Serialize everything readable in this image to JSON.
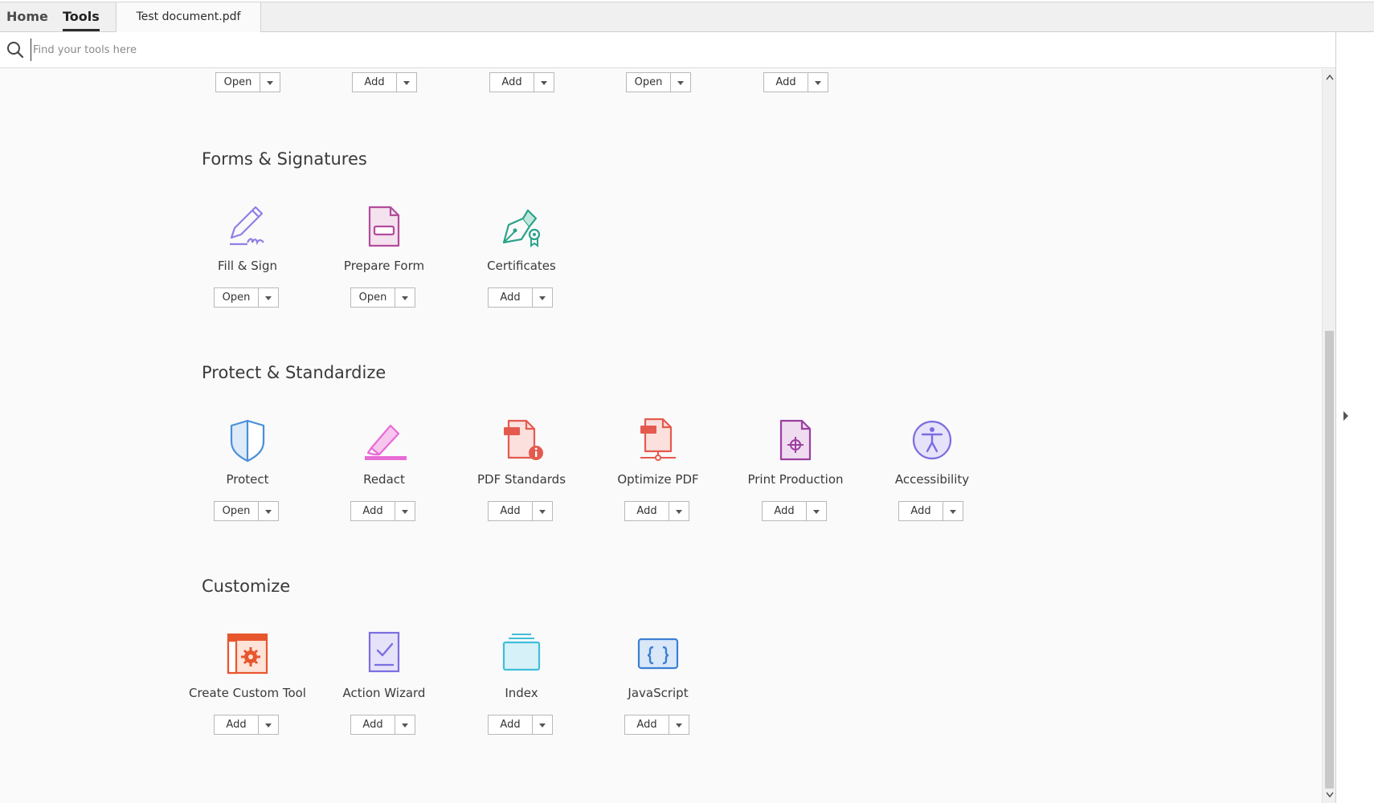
{
  "tabs": {
    "home": "Home",
    "tools": "Tools",
    "document": "Test document.pdf"
  },
  "search": {
    "placeholder": "Find your tools here"
  },
  "top_row": [
    {
      "button": "Open"
    },
    {
      "button": "Add"
    },
    {
      "button": "Add"
    },
    {
      "button": "Open"
    },
    {
      "button": "Add"
    }
  ],
  "sections": {
    "forms": {
      "title": "Forms & Signatures",
      "tools": [
        {
          "label": "Fill & Sign",
          "button": "Open",
          "icon": "fill-sign-icon"
        },
        {
          "label": "Prepare Form",
          "button": "Open",
          "icon": "prepare-form-icon"
        },
        {
          "label": "Certificates",
          "button": "Add",
          "icon": "certificates-icon"
        }
      ]
    },
    "protect": {
      "title": "Protect & Standardize",
      "tools": [
        {
          "label": "Protect",
          "button": "Open",
          "icon": "shield-icon"
        },
        {
          "label": "Redact",
          "button": "Add",
          "icon": "redact-icon"
        },
        {
          "label": "PDF Standards",
          "button": "Add",
          "icon": "pdf-standards-icon"
        },
        {
          "label": "Optimize PDF",
          "button": "Add",
          "icon": "optimize-pdf-icon"
        },
        {
          "label": "Print Production",
          "button": "Add",
          "icon": "print-production-icon"
        },
        {
          "label": "Accessibility",
          "button": "Add",
          "icon": "accessibility-icon"
        }
      ]
    },
    "customize": {
      "title": "Customize",
      "tools": [
        {
          "label": "Create Custom Tool",
          "button": "Add",
          "icon": "create-custom-tool-icon"
        },
        {
          "label": "Action Wizard",
          "button": "Add",
          "icon": "action-wizard-icon"
        },
        {
          "label": "Index",
          "button": "Add",
          "icon": "index-icon"
        },
        {
          "label": "JavaScript",
          "button": "Add",
          "icon": "javascript-icon"
        }
      ]
    }
  },
  "colors": {
    "fill_sign": "#8f7fe6",
    "prepare_form": "#b24c9c",
    "certificates": "#2ba38a",
    "protect": "#4a90d9",
    "redact": "#e86bd6",
    "pdf_standards": "#e55a4e",
    "optimize": "#e55a4e",
    "print_production": "#9b3fa0",
    "accessibility": "#7b6ee0",
    "custom_tool": "#e8562e",
    "action_wizard": "#7b6ee0",
    "index": "#3fbfd9",
    "javascript": "#3b7fd4"
  }
}
